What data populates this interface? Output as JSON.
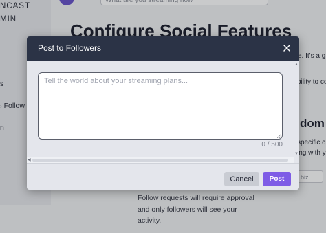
{
  "background": {
    "brand": {
      "line1": "NCAST",
      "line2": "MIN"
    },
    "brand_mark": "P",
    "search": {
      "placeholder": "What are you streaming now"
    },
    "sidebar_items": [
      "s",
      "Follow",
      "n"
    ],
    "heading": "Configure Social Features",
    "fragments": [
      "ce. It's a g",
      "bility to co",
      "specific c",
      "ing with yo"
    ],
    "domain_heading": "dom",
    "domain_input": "biz",
    "follow_help": "Follow requests will require approval and only followers will see your activity."
  },
  "modal": {
    "title": "Post to Followers",
    "close_icon": "close-icon",
    "textarea": {
      "value": "",
      "placeholder": "Tell the world about your streaming plans..."
    },
    "char_count": "0 / 500",
    "buttons": {
      "cancel": "Cancel",
      "post": "Post"
    }
  },
  "colors": {
    "header_bg": "#2b3346",
    "post_button": "#7e5ce6",
    "cancel_button": "#c9ccd3",
    "modal_bg": "#e4e6ec"
  }
}
